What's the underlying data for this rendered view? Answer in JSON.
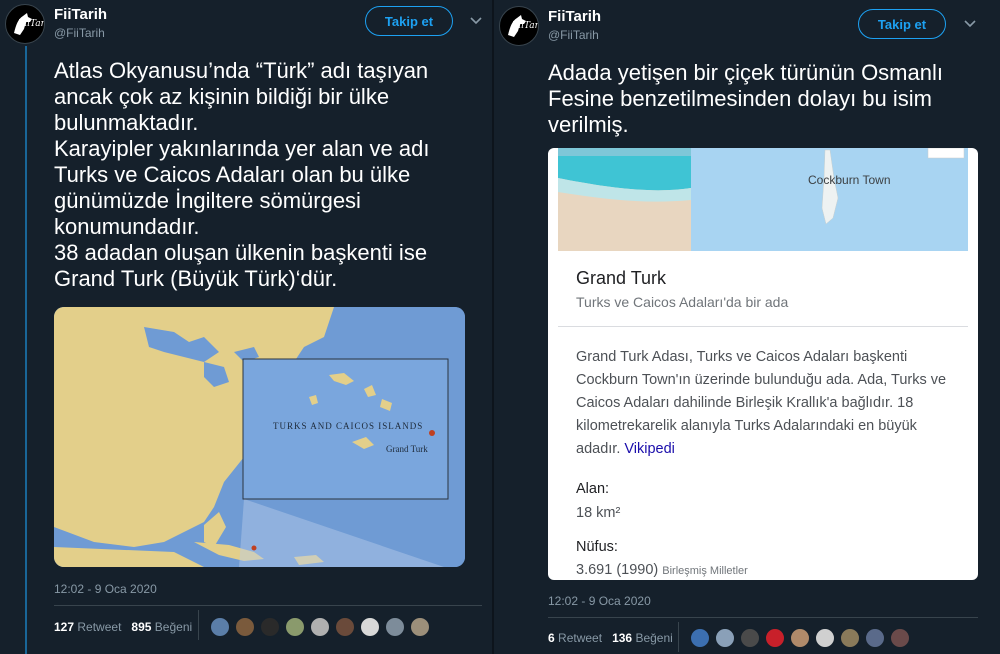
{
  "left_tweet": {
    "user_name": "FiiTarih",
    "handle": "@FiiTarih",
    "avatar_text": "FiiTarih",
    "follow_label": "Takip et",
    "text": "Atlas Okyanusu’nda “Türk” adı taşıyan ancak çok az kişinin bildiği bir ülke bulunmaktadır.\nKarayipler yakınlarında yer alan ve adı Turks ve Caicos Adaları olan bu ülke günümüzde İngiltere sömürgesi konumundadır.\n38 adadan oluşan ülkenin başkenti ise Grand Turk (Büyük Türk)‘dür.",
    "map": {
      "islands_label": "TURKS AND CAICOS ISLANDS",
      "capital_label": "Grand Turk"
    },
    "timestamp": "12:02 - 9 Oca 2020",
    "retweets_count": "127",
    "retweets_label": "Retweet",
    "likes_count": "895",
    "likes_label": "Beğeni"
  },
  "right_tweet": {
    "user_name": "FiiTarih",
    "handle": "@FiiTarih",
    "avatar_text": "FiiTarih",
    "follow_label": "Takip et",
    "text": "Adada yetişen bir çiçek türünün Osmanlı Fesine benzetilmesinden dolayı bu isim verilmiş.",
    "card": {
      "map_town": "Cockburn Town",
      "title": "Grand Turk",
      "subtitle": "Turks ve Caicos Adaları'da bir ada",
      "description": "Grand Turk Adası, Turks ve Caicos Adaları başkenti Cockburn Town'ın üzerinde bulunduğu ada. Ada, Turks ve Caicos Adaları dahilinde Birleşik Krallık'a bağlıdır. 18 kilometrekarelik alanıyla Turks Adalarındaki en büyük adadır.",
      "description_link": "Vikipedi",
      "area_label": "Alan:",
      "area_value": "18 km²",
      "population_label": "Nüfus:",
      "population_value": "3.691 (1990)",
      "population_source": "Birleşmiş Milletler"
    },
    "timestamp": "12:02 - 9 Oca 2020",
    "retweets_count": "6",
    "retweets_label": "Retweet",
    "likes_count": "136",
    "likes_label": "Beğeni"
  },
  "colors": {
    "background": "#15202b",
    "accent": "#1da1f2",
    "muted": "#8899a6",
    "divider": "#38444d"
  },
  "icons": {
    "chevron": "chevron-down-icon"
  }
}
